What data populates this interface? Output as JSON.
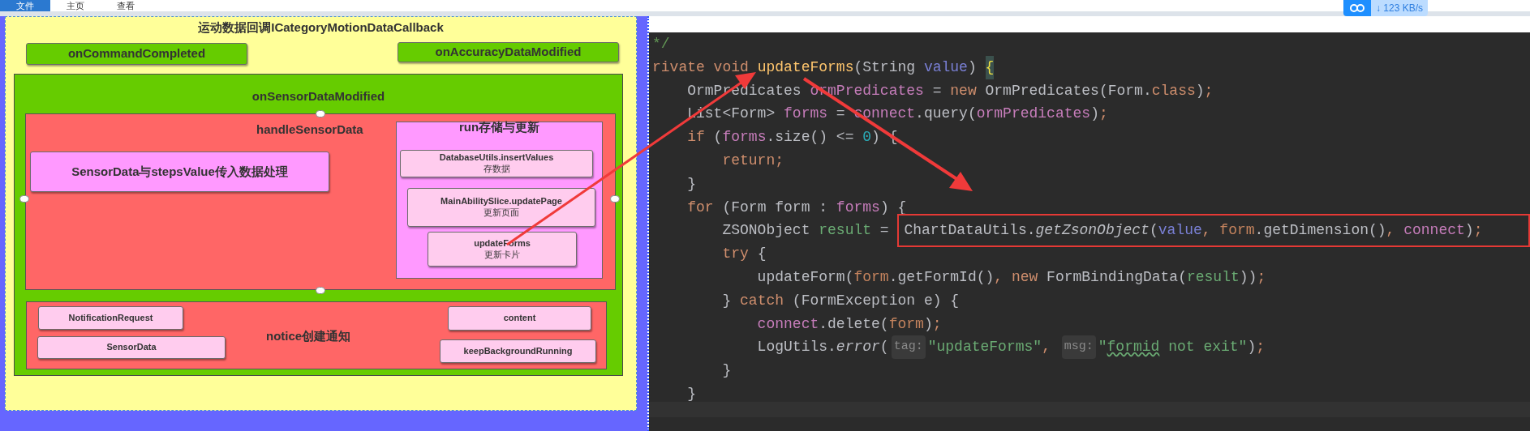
{
  "menu": [
    {
      "label": "文件",
      "selected": true
    },
    {
      "label": "主页",
      "selected": false
    },
    {
      "label": "查看",
      "selected": false
    }
  ],
  "net_speed": {
    "text": "↓ 123 KB/s"
  },
  "diagram": {
    "title": "运动数据回调ICategoryMotionDataCallback",
    "top_nodes": [
      {
        "label": "onCommandCompleted"
      },
      {
        "label": "onAccuracyDataModified"
      }
    ],
    "sensor": {
      "title": "onSensorDataModified",
      "handle": {
        "title": "handleSensorData",
        "input": "SensorData与stepsValue传入数据处理",
        "run": {
          "title": "run存储与更新",
          "steps": [
            {
              "name": "DatabaseUtils.insertValues",
              "note": "存数据"
            },
            {
              "name": "MainAbilitySlice.updatePage",
              "note": "更新页面"
            },
            {
              "name": "updateForms",
              "note": "更新卡片"
            }
          ]
        }
      },
      "notice": {
        "title": "notice创建通知",
        "items": [
          {
            "label": "NotificationRequest"
          },
          {
            "label": "SensorData"
          },
          {
            "label": "content"
          },
          {
            "label": "keepBackgroundRunning"
          }
        ]
      }
    }
  },
  "code": {
    "lines": [
      {
        "tokens": [
          {
            "text": "*/",
            "kind": "comment"
          }
        ]
      },
      {
        "tokens": [
          {
            "text": "rivate void ",
            "kind": "keyword"
          },
          {
            "text": "updateForms",
            "kind": "declaration"
          },
          {
            "text": "(String ",
            "kind": "plain"
          },
          {
            "text": "value",
            "kind": "parameter"
          },
          {
            "text": ") ",
            "kind": "plain"
          },
          {
            "text": "{",
            "kind": "brace_match"
          }
        ]
      },
      {
        "tokens": [
          {
            "text": "    OrmPredicates ",
            "kind": "plain"
          },
          {
            "text": "ormPredicates",
            "kind": "variable"
          },
          {
            "text": " = ",
            "kind": "plain"
          },
          {
            "text": "new",
            "kind": "keyword"
          },
          {
            "text": " OrmPredicates(Form.",
            "kind": "plain"
          },
          {
            "text": "class",
            "kind": "keyword"
          },
          {
            "text": ")",
            "kind": "plain"
          },
          {
            "text": ";",
            "kind": "keyword"
          }
        ]
      },
      {
        "tokens": [
          {
            "text": "    List<Form> ",
            "kind": "plain"
          },
          {
            "text": "forms",
            "kind": "variable"
          },
          {
            "text": " = ",
            "kind": "plain"
          },
          {
            "text": "connect",
            "kind": "variable"
          },
          {
            "text": ".query(",
            "kind": "plain"
          },
          {
            "text": "ormPredicates",
            "kind": "variable"
          },
          {
            "text": ")",
            "kind": "plain"
          },
          {
            "text": ";",
            "kind": "keyword"
          }
        ]
      },
      {
        "tokens": [
          {
            "text": "    if",
            "kind": "keyword"
          },
          {
            "text": " (",
            "kind": "plain"
          },
          {
            "text": "forms",
            "kind": "variable"
          },
          {
            "text": ".size() <= ",
            "kind": "plain"
          },
          {
            "text": "0",
            "kind": "number"
          },
          {
            "text": ") {",
            "kind": "plain"
          }
        ]
      },
      {
        "tokens": [
          {
            "text": "        return;",
            "kind": "keyword"
          }
        ]
      },
      {
        "tokens": [
          {
            "text": "    }",
            "kind": "plain"
          }
        ]
      },
      {
        "tokens": [
          {
            "text": "    for",
            "kind": "keyword"
          },
          {
            "text": " (Form form : ",
            "kind": "plain"
          },
          {
            "text": "forms",
            "kind": "variable"
          },
          {
            "text": ") {",
            "kind": "plain"
          }
        ]
      },
      {
        "tokens": [
          {
            "text": "        ZSONObject ",
            "kind": "plain"
          },
          {
            "text": "result",
            "kind": "local"
          },
          {
            "text": " = ",
            "kind": "plain"
          }
        ],
        "boxed_tokens": [
          {
            "text": "ChartDataUtils.",
            "kind": "plain"
          },
          {
            "text": "getZsonObject",
            "kind": "static_call"
          },
          {
            "text": "(",
            "kind": "plain"
          },
          {
            "text": "value",
            "kind": "parameter"
          },
          {
            "text": ", ",
            "kind": "keyword"
          },
          {
            "text": "form",
            "kind": "loop_var"
          },
          {
            "text": ".getDimension()",
            "kind": "plain"
          },
          {
            "text": ", ",
            "kind": "keyword"
          },
          {
            "text": "connect",
            "kind": "variable"
          },
          {
            "text": ")",
            "kind": "plain"
          },
          {
            "text": ";",
            "kind": "keyword"
          }
        ]
      },
      {
        "tokens": [
          {
            "text": "        try",
            "kind": "keyword"
          },
          {
            "text": " {",
            "kind": "plain"
          }
        ]
      },
      {
        "tokens": [
          {
            "text": "            updateForm(",
            "kind": "plain"
          },
          {
            "text": "form",
            "kind": "loop_var"
          },
          {
            "text": ".getFormId()",
            "kind": "plain"
          },
          {
            "text": ", new",
            "kind": "keyword"
          },
          {
            "text": " FormBindingData(",
            "kind": "plain"
          },
          {
            "text": "result",
            "kind": "local"
          },
          {
            "text": "))",
            "kind": "plain"
          },
          {
            "text": ";",
            "kind": "keyword"
          }
        ]
      },
      {
        "tokens": [
          {
            "text": "        } ",
            "kind": "plain"
          },
          {
            "text": "catch",
            "kind": "keyword"
          },
          {
            "text": " (FormException e) {",
            "kind": "plain"
          }
        ]
      },
      {
        "tokens": [
          {
            "text": "            connect",
            "kind": "variable"
          },
          {
            "text": ".delete(",
            "kind": "plain"
          },
          {
            "text": "form",
            "kind": "loop_var"
          },
          {
            "text": ")",
            "kind": "plain"
          },
          {
            "text": ";",
            "kind": "keyword"
          }
        ]
      },
      {
        "tokens": [
          {
            "text": "            LogUtils.",
            "kind": "plain"
          },
          {
            "text": "error",
            "kind": "static_call"
          },
          {
            "text": "(",
            "kind": "plain"
          },
          {
            "text": "tag:",
            "kind": "hint"
          },
          {
            "text": "\"updateForms\"",
            "kind": "string"
          },
          {
            "text": ", ",
            "kind": "keyword"
          },
          {
            "text": "msg:",
            "kind": "hint"
          },
          {
            "text": "\"",
            "kind": "string"
          },
          {
            "text": "formid",
            "kind": "string_warn"
          },
          {
            "text": " not exit\"",
            "kind": "string"
          },
          {
            "text": ")",
            "kind": "plain"
          },
          {
            "text": ";",
            "kind": "keyword"
          }
        ]
      },
      {
        "tokens": [
          {
            "text": "        }",
            "kind": "plain"
          }
        ]
      },
      {
        "tokens": [
          {
            "text": "    }",
            "kind": "plain"
          }
        ]
      }
    ]
  }
}
